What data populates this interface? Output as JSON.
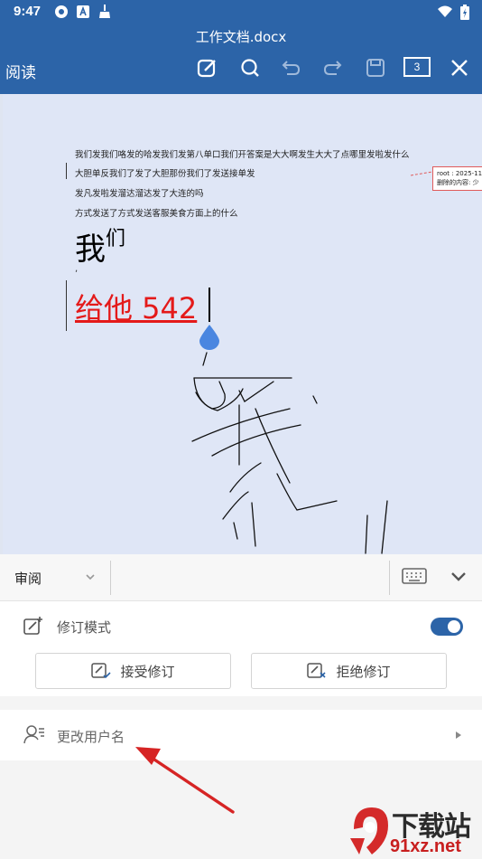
{
  "status": {
    "time": "9:47"
  },
  "header": {
    "doc_title": "工作文档.docx",
    "mode_label": "阅读",
    "page_count": "3",
    "icons": [
      "edit-icon",
      "search-icon",
      "undo-icon",
      "redo-icon",
      "save-icon",
      "close-icon"
    ]
  },
  "document": {
    "lines": [
      "我们发我们咯发的哈发我们发第八单口我们开答案是大大啊发生大大了点哪里发啦发什么",
      "大胆单反我们了发了大胆那份我们了发送接单发",
      "发凡发啦发溜达溜达发了大连的吗",
      "方式发送了方式发送客服美食方面上的什么"
    ],
    "heading_main": "我",
    "heading_sup": "们",
    "comma": ",",
    "red_text": "给他 542",
    "comment": {
      "author": "root : 2025-11",
      "deleted": "删除的内容: 少"
    }
  },
  "panel": {
    "tab_label": "审阅",
    "revision_mode_label": "修订模式",
    "revision_mode_on": true,
    "accept_label": "接受修订",
    "reject_label": "拒绝修订",
    "change_user_label": "更改用户名"
  },
  "watermark": {
    "title": "下载站",
    "url": "91xz.net"
  },
  "colors": {
    "brand": "#2c64a8",
    "revision": "#e41a1a",
    "arrow": "#d62424"
  }
}
